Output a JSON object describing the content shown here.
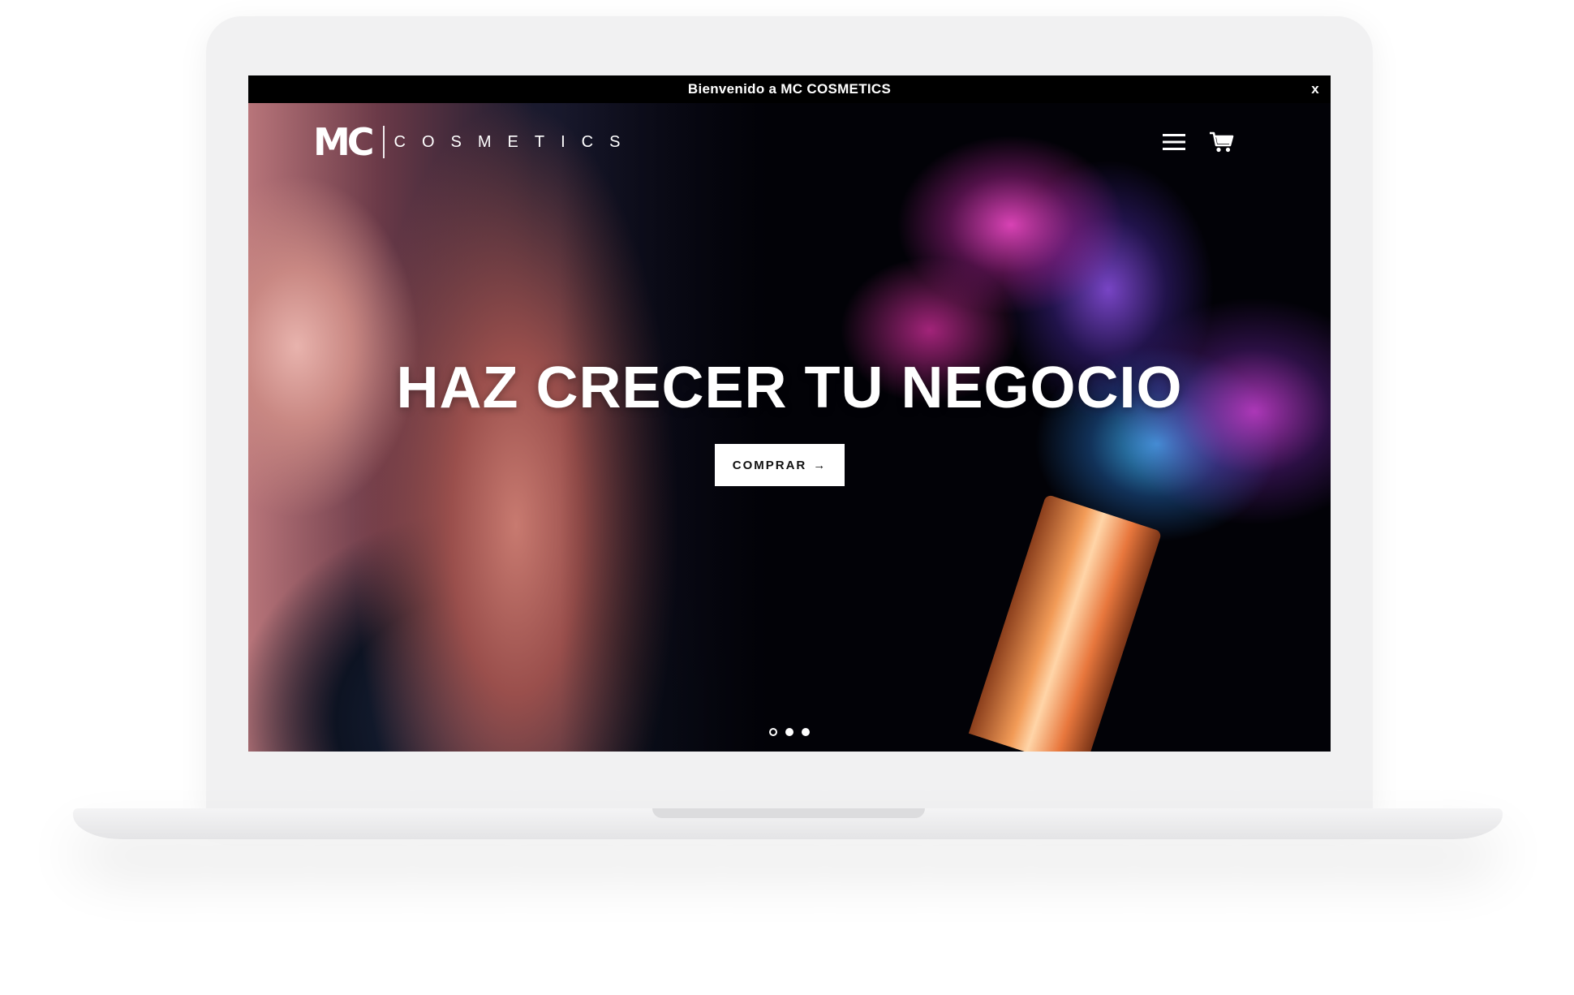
{
  "announcement": {
    "text": "Bienvenido a MC COSMETICS",
    "close_label": "x"
  },
  "header": {
    "logo_mark": "MC",
    "logo_word": "COSMETICS",
    "menu_icon": "hamburger-menu-icon",
    "cart_icon": "shopping-cart-icon"
  },
  "hero": {
    "title": "HAZ CRECER TU NEGOCIO",
    "cta_label": "COMPRAR",
    "cta_arrow": "→",
    "slides": {
      "count": 3,
      "active": 1
    }
  },
  "colors": {
    "announcement_bg": "#000000",
    "cta_bg": "#ffffff",
    "text": "#ffffff",
    "mockup_frame": "#f1f1f2"
  }
}
